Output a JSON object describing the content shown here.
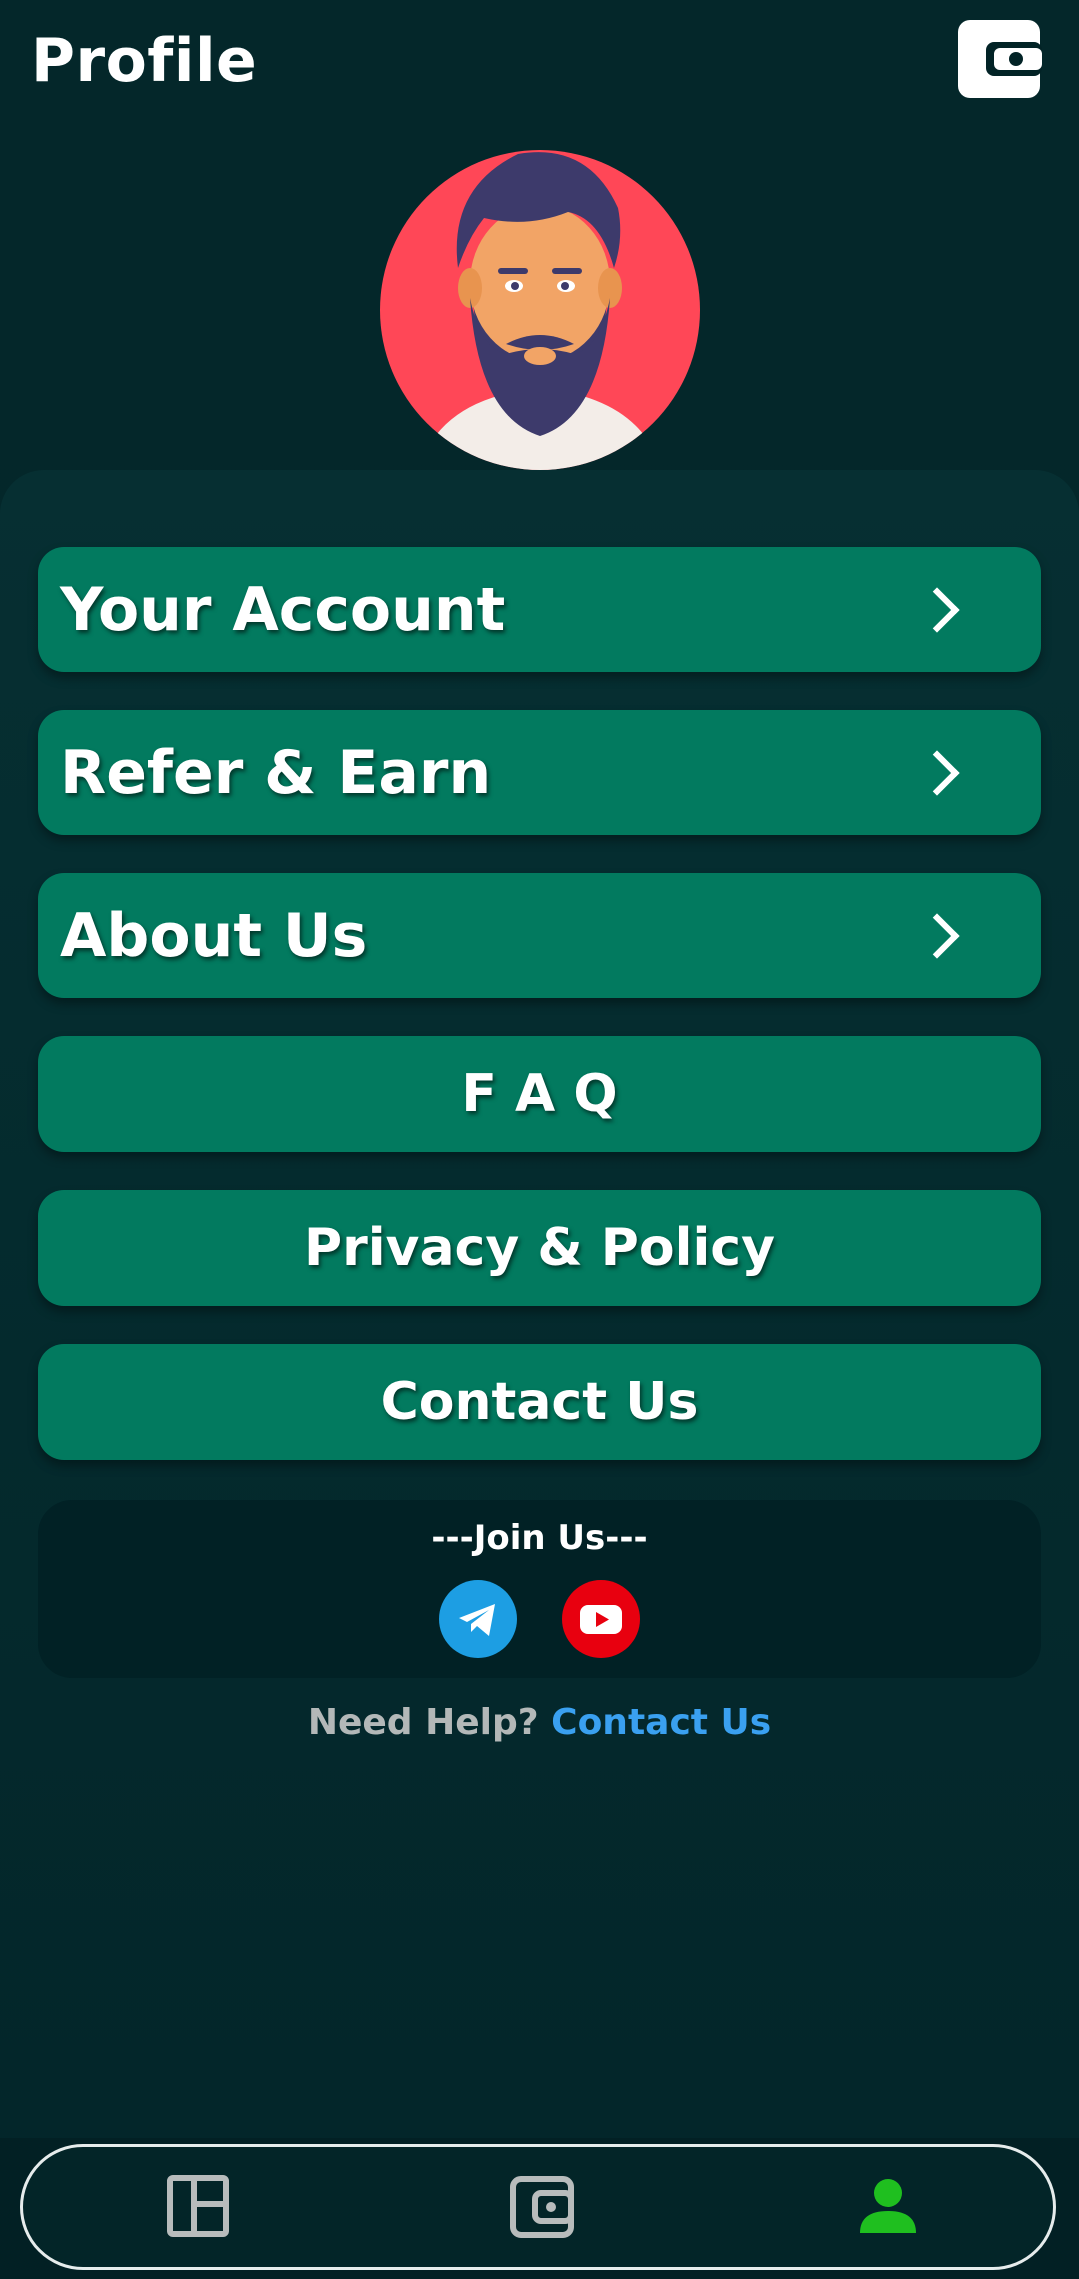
{
  "header": {
    "title": "Profile",
    "wallet_icon": "wallet-icon"
  },
  "avatar": {
    "icon": "bearded-man-avatar"
  },
  "menu": {
    "your_account": "Your Account",
    "refer_earn": "Refer & Earn",
    "about_us": "About Us",
    "faq": "F A Q",
    "privacy_policy": "Privacy & Policy",
    "contact_us": "Contact Us"
  },
  "join": {
    "title": "---Join Us---",
    "icons": [
      "telegram-icon",
      "youtube-icon"
    ]
  },
  "help": {
    "prefix": "Need Help? ",
    "link": "Contact Us"
  },
  "bottom_nav": {
    "items": [
      "dashboard-icon",
      "wallet-icon",
      "profile-icon"
    ],
    "active": "profile-icon"
  },
  "colors": {
    "background": "#03262a",
    "button": "#027a5f",
    "active_nav": "#1fbf1f",
    "link": "#3aa0f0",
    "avatar_circle": "#ff4757"
  }
}
